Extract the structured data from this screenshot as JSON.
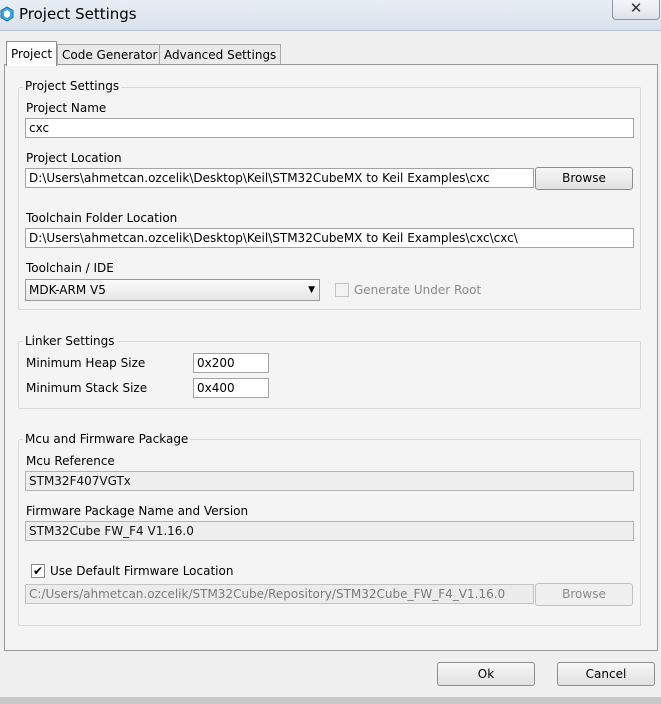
{
  "window": {
    "title": "Project Settings",
    "close_glyph": "✕"
  },
  "tabs": [
    {
      "label": "Project",
      "active": true
    },
    {
      "label": "Code Generator",
      "active": false
    },
    {
      "label": "Advanced Settings",
      "active": false
    }
  ],
  "project_settings": {
    "title": "Project Settings",
    "name_label": "Project Name",
    "name_value": "cxc",
    "location_label": "Project Location",
    "location_value": "D:\\Users\\ahmetcan.ozcelik\\Desktop\\Keil\\STM32CubeMX to Keil Examples\\cxc",
    "browse_label": "Browse",
    "toolchain_folder_label": "Toolchain Folder Location",
    "toolchain_folder_value": "D:\\Users\\ahmetcan.ozcelik\\Desktop\\Keil\\STM32CubeMX to Keil Examples\\cxc\\cxc\\",
    "toolchain_label": "Toolchain / IDE",
    "toolchain_value": "MDK-ARM V5",
    "generate_under_root_label": "Generate Under Root",
    "generate_under_root_checked": false
  },
  "linker_settings": {
    "title": "Linker Settings",
    "heap_label": "Minimum Heap Size",
    "heap_value": "0x200",
    "stack_label": "Minimum Stack Size",
    "stack_value": "0x400"
  },
  "mcu_firmware": {
    "title": "Mcu and Firmware Package",
    "mcu_ref_label": "Mcu Reference",
    "mcu_ref_value": "STM32F407VGTx",
    "fw_label": "Firmware Package Name and Version",
    "fw_value": "STM32Cube FW_F4 V1.16.0",
    "use_default_label": "Use Default Firmware Location",
    "use_default_checked": true,
    "checkmark": "✔",
    "fw_location_value": "C:/Users/ahmetcan.ozcelik/STM32Cube/Repository/STM32Cube_FW_F4_V1.16.0",
    "browse_label": "Browse"
  },
  "footer": {
    "ok_label": "Ok",
    "cancel_label": "Cancel"
  },
  "colors": {
    "titlebar": "#dbe3ee",
    "panel": "#f4f4f4",
    "border": "#9a9a9a"
  },
  "icons": {
    "app": "stm32cubemx-cube-icon",
    "dropdown": "chevron-down-icon",
    "close": "close-icon"
  }
}
